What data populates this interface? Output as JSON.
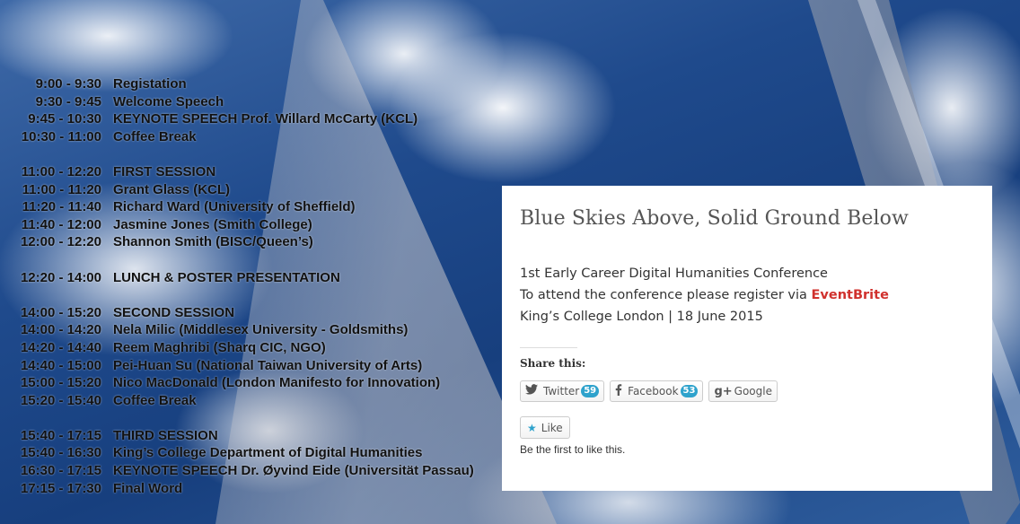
{
  "schedule": [
    {
      "time": "9:00 - 9:30",
      "label": "Registation",
      "gap": false
    },
    {
      "time": "9:30 - 9:45",
      "label": "Welcome Speech",
      "gap": false
    },
    {
      "time": "9:45 - 10:30",
      "label": "KEYNOTE SPEECH Prof. Willard McCarty (KCL)",
      "gap": false
    },
    {
      "time": "10:30 - 11:00",
      "label": "Coffee Break",
      "gap": false
    },
    {
      "time": "11:00 - 12:20",
      "label": "FIRST SESSION",
      "gap": true
    },
    {
      "time": "11:00 - 11:20",
      "label": "Grant Glass (KCL)",
      "gap": false
    },
    {
      "time": "11:20 - 11:40",
      "label": "Richard Ward (University of Sheffield)",
      "gap": false
    },
    {
      "time": "11:40 - 12:00",
      "label": "Jasmine Jones (Smith College)",
      "gap": false
    },
    {
      "time": "12:00 - 12:20",
      "label": "Shannon Smith (BISC/Queen’s)",
      "gap": false
    },
    {
      "time": "12:20 - 14:00",
      "label": "LUNCH & POSTER PRESENTATION",
      "gap": true
    },
    {
      "time": "14:00 - 15:20",
      "label": "SECOND SESSION",
      "gap": true
    },
    {
      "time": "14:00 - 14:20",
      "label": "Nela Milic (Middlesex University - Goldsmiths)",
      "gap": false
    },
    {
      "time": "14:20 - 14:40",
      "label": "Reem Maghribi (Sharq CIC, NGO)",
      "gap": false
    },
    {
      "time": "14:40 - 15:00",
      "label": "Pei-Huan Su (National Taiwan University of Arts)",
      "gap": false
    },
    {
      "time": "15:00 - 15:20",
      "label": "Nico MacDonald (London Manifesto for Innovation)",
      "gap": false
    },
    {
      "time": "15:20 - 15:40",
      "label": "Coffee Break",
      "gap": false
    },
    {
      "time": "15:40 - 17:15",
      "label": "THIRD SESSION",
      "gap": true
    },
    {
      "time": "15:40 - 16:30",
      "label": "King’s College Department of Digital Humanities",
      "gap": false
    },
    {
      "time": "16:30 - 17:15",
      "label": "KEYNOTE SPEECH Dr. Øyvind Eide (Universität Passau)",
      "gap": false
    },
    {
      "time": "17:15 - 17:30",
      "label": "Final Word",
      "gap": false
    }
  ],
  "card": {
    "title": "Blue Skies Above, Solid Ground Below",
    "line1": "1st Early Career Digital Humanities Conference",
    "line2_prefix": "To attend the conference please register via ",
    "line2_link": "EventBrite",
    "line3": "King’s College London | 18 June 2015",
    "share_title": "Share this:",
    "share_buttons": [
      {
        "name": "twitter",
        "icon": "twitter-icon",
        "label": "Twitter",
        "count": "59"
      },
      {
        "name": "facebook",
        "icon": "facebook-icon",
        "label": "Facebook",
        "count": "53"
      },
      {
        "name": "google",
        "icon": "google-plus-icon",
        "label": "Google",
        "count": ""
      }
    ],
    "like_label": "Like",
    "like_note": "Be the first to like this."
  },
  "colors": {
    "link": "#d0312d",
    "badge": "#2ea2cc"
  }
}
